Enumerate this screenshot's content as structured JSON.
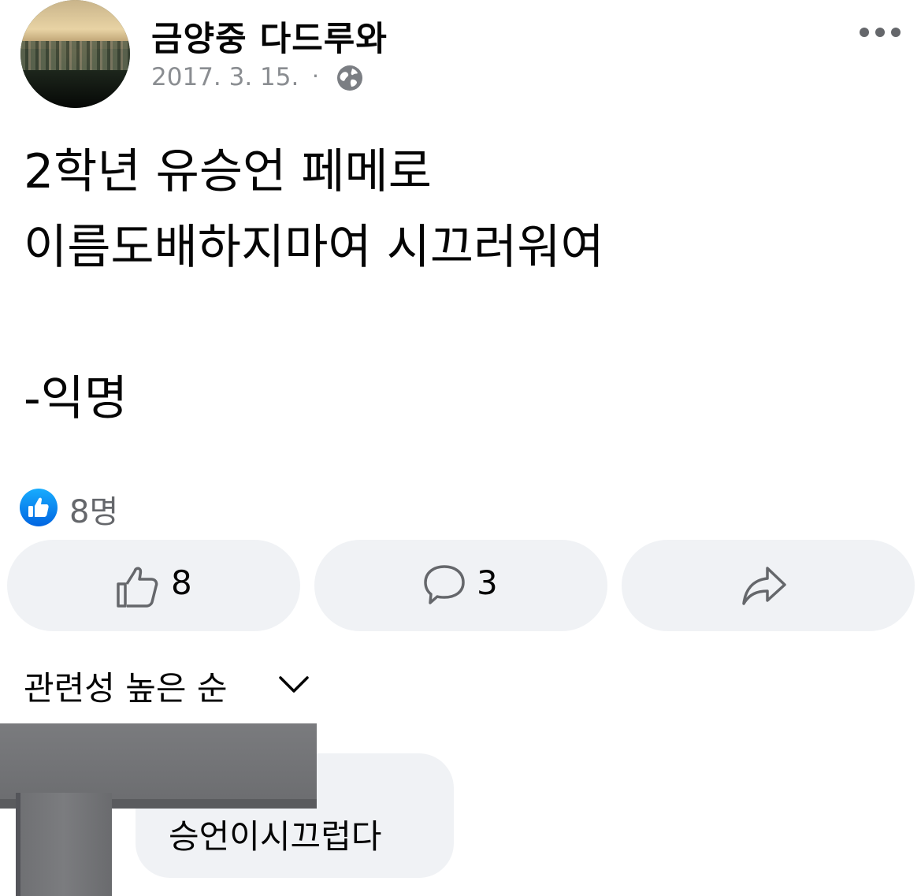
{
  "post": {
    "author": "금양중 다드루와",
    "date": "2017. 3. 15.",
    "separator": "·",
    "privacy_icon": "globe-icon",
    "body": "2학년 유승언 페메로\n이름도배하지마여 시끄러워여\n\n-익명"
  },
  "reactions": {
    "icon": "like-badge-icon",
    "summary": "8명"
  },
  "actions": {
    "like_count": "8",
    "comment_count": "3",
    "share_icon": "share-icon"
  },
  "comments": {
    "sort_label": "관련성 높은 순",
    "items": [
      {
        "text": "승언이시끄럽다"
      }
    ]
  },
  "colors": {
    "accent": "#1877f2",
    "secondary_text": "#65676b",
    "button_bg": "#f0f2f5"
  }
}
